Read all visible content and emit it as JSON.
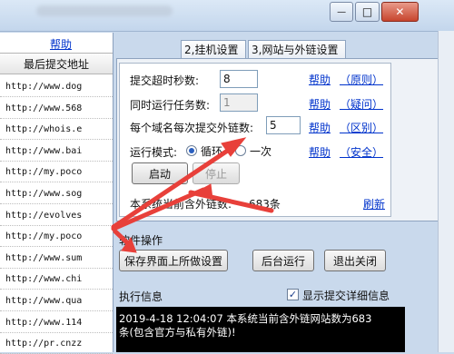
{
  "window": {
    "minimize_glyph": "—",
    "maximize_glyph": "□",
    "close_glyph": "✕"
  },
  "left_panel": {
    "help_link": "帮助",
    "column_header": "最后提交地址",
    "urls": [
      "http://www.dog",
      "http://www.568",
      "http://whois.e",
      "http://www.bai",
      "http://my.poco",
      "http://www.sog",
      "http://evolves",
      "http://my.poco",
      "http://www.sum",
      "http://www.chi",
      "http://www.qua",
      "http://www.114",
      "http://pr.cnzz"
    ]
  },
  "tabs": [
    {
      "label": "2,挂机设置"
    },
    {
      "label": "3,网站与外链设置"
    }
  ],
  "settings": {
    "timeout_label": "提交超时秒数:",
    "timeout_value": "8",
    "parallel_label": "同时运行任务数:",
    "parallel_value": "1",
    "links_label": "每个域名每次提交外链数:",
    "links_value": "5",
    "mode_label": "运行模式:",
    "mode_loop": "循环",
    "mode_once": "一次",
    "help": "帮助",
    "hint_principle": "（原则）",
    "hint_question": "（疑问）",
    "hint_difference": "（区别）",
    "hint_safety": "（安全）",
    "start_button": "启动",
    "stop_button": "停止",
    "total_label": "本系统当前含外链数:",
    "total_value": "683条",
    "refresh_link": "刷新"
  },
  "operations": {
    "section_title": "软件操作",
    "save_button": "保存界面上所做设置",
    "background_button": "后台运行",
    "exit_button": "退出关闭"
  },
  "log": {
    "section_title": "执行信息",
    "show_details_label": "显示提交详细信息",
    "show_details_checked": "✓",
    "lines": [
      "2019-4-18 12:04:07  本系统当前含外链网站数为683",
      "条(包含官方与私有外链)!"
    ]
  },
  "colors": {
    "arrow": "#e8403a",
    "link": "#0033cc"
  }
}
